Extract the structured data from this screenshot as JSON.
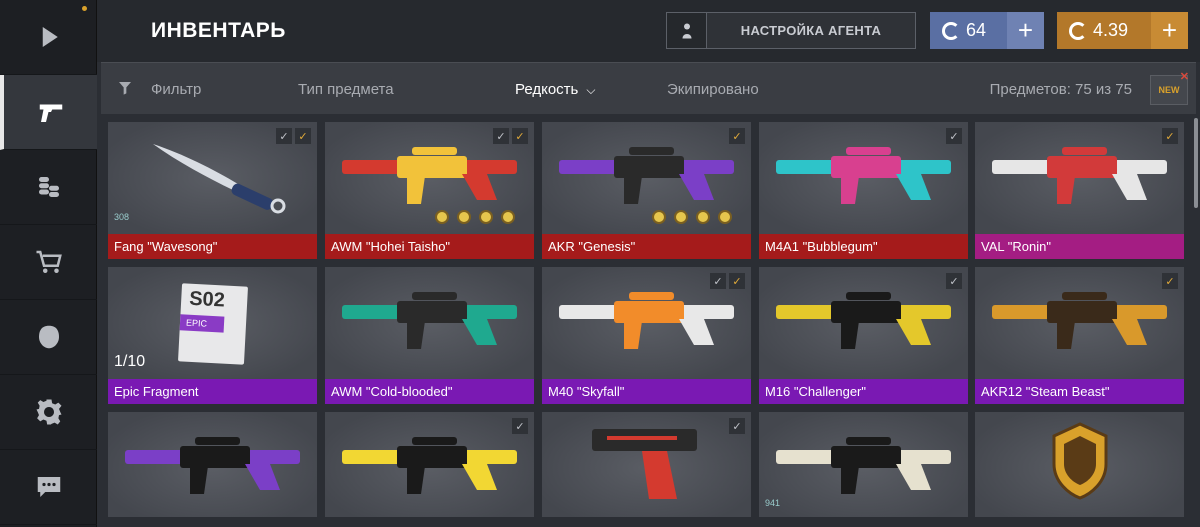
{
  "header": {
    "title": "ИНВЕНТАРЬ",
    "agent_button": "НАСТРОЙКА АГЕНТА",
    "silver_amount": "64",
    "gold_amount": "4.39"
  },
  "filters": {
    "filter": "Фильтр",
    "item_type": "Тип предмета",
    "rarity": "Редкость",
    "equipped": "Экипировано",
    "count": "Предметов: 75 из 75",
    "new_badge": "NEW"
  },
  "sidebar": [
    "play-icon",
    "pistol-icon",
    "coins-icon",
    "cart-icon",
    "clan-icon",
    "gear-icon",
    "chat-icon"
  ],
  "items": [
    {
      "name": "Fang \"Wavesong\"",
      "rarity": "red",
      "checks": [
        "grey",
        "gold"
      ],
      "badge": "308"
    },
    {
      "name": "AWM \"Hohei Taisho\"",
      "rarity": "red",
      "checks": [
        "grey",
        "gold"
      ]
    },
    {
      "name": "AKR \"Genesis\"",
      "rarity": "red",
      "checks": [
        "gold"
      ]
    },
    {
      "name": "M4A1 \"Bubblegum\"",
      "rarity": "red",
      "checks": [
        "grey"
      ]
    },
    {
      "name": "VAL \"Ronin\"",
      "rarity": "pink",
      "checks": [
        "gold"
      ]
    },
    {
      "name": "Epic Fragment",
      "rarity": "purple",
      "checks": [],
      "fragment": "1/10",
      "frag_label": "S02",
      "frag_sub": "EPIC"
    },
    {
      "name": "AWM \"Cold-blooded\"",
      "rarity": "purple",
      "checks": []
    },
    {
      "name": "M40 \"Skyfall\"",
      "rarity": "purple",
      "checks": [
        "grey",
        "gold"
      ]
    },
    {
      "name": "M16 \"Challenger\"",
      "rarity": "purple",
      "checks": [
        "grey"
      ]
    },
    {
      "name": "AKR12 \"Steam Beast\"",
      "rarity": "purple",
      "checks": [
        "gold"
      ]
    },
    {
      "name": "",
      "rarity": "purple",
      "checks": []
    },
    {
      "name": "",
      "rarity": "purple",
      "checks": [
        "grey"
      ]
    },
    {
      "name": "",
      "rarity": "purple",
      "checks": [
        "grey"
      ]
    },
    {
      "name": "",
      "rarity": "purple",
      "checks": [],
      "badge": "941"
    },
    {
      "name": "",
      "rarity": "purple",
      "checks": []
    }
  ],
  "colors": {
    "red": "#a51b1b",
    "pink": "#a41d83",
    "purple": "#7a19b3",
    "silver": "#5a6fa3",
    "gold": "#b3782a"
  }
}
